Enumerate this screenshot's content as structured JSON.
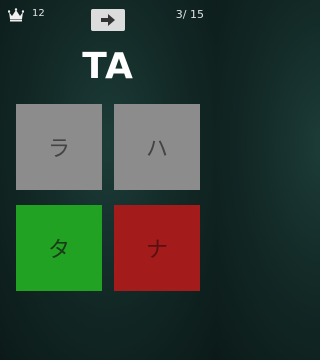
{
  "header": {
    "crown_icon": "crown-icon",
    "score": "12",
    "next_icon": "arrow-right-icon",
    "progress": "3/ 15"
  },
  "question": {
    "romaji": "TA"
  },
  "choices": [
    {
      "label": "ラ",
      "state": "neutral"
    },
    {
      "label": "ハ",
      "state": "neutral"
    },
    {
      "label": "タ",
      "state": "correct"
    },
    {
      "label": "ナ",
      "state": "wrong"
    }
  ],
  "colors": {
    "neutral": "#8c8c8c",
    "correct": "#22a222",
    "wrong": "#a31b1b",
    "background": "#132a27"
  }
}
